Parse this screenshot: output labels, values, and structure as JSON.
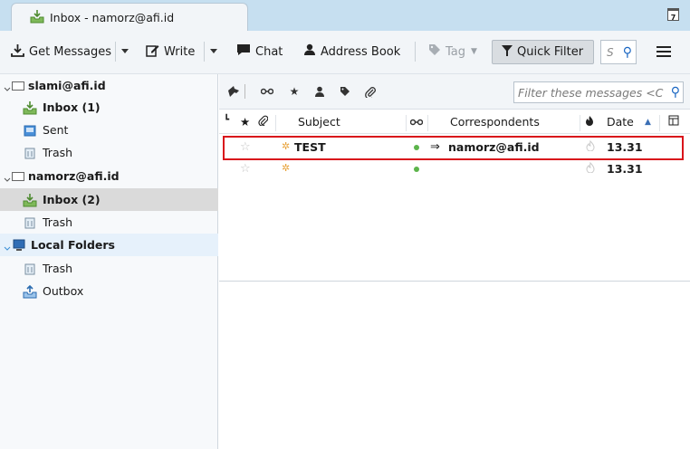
{
  "window": {
    "tab_title": "Inbox - namorz@afi.id",
    "calendar_day": "7"
  },
  "toolbar": {
    "get_messages": "Get Messages",
    "write": "Write",
    "chat": "Chat",
    "address_book": "Address Book",
    "tag": "Tag",
    "quick_filter": "Quick Filter",
    "search_placeholder": "S"
  },
  "folders": {
    "account1": "slami@afi.id",
    "account1_inbox": "Inbox (1)",
    "account1_sent": "Sent",
    "account1_trash": "Trash",
    "account2": "namorz@afi.id",
    "account2_inbox": "Inbox (2)",
    "account2_trash": "Trash",
    "local": "Local Folders",
    "local_trash": "Trash",
    "local_outbox": "Outbox"
  },
  "quick_filter_bar": {
    "filter_placeholder": "Filter these messages <C"
  },
  "columns": {
    "subject": "Subject",
    "correspondents": "Correspondents",
    "date": "Date"
  },
  "messages": [
    {
      "subject": "TEST",
      "correspondent": "namorz@afi.id",
      "date": "13.31",
      "unread": true,
      "selected": true
    },
    {
      "subject": "",
      "correspondent": "",
      "date": "13.31",
      "unread": true,
      "selected": false
    }
  ],
  "colors": {
    "tabstrip": "#c6dff0",
    "toolbar": "#f2f5f8",
    "selection_border": "#d9141b",
    "online_dot": "#5cb44b"
  }
}
